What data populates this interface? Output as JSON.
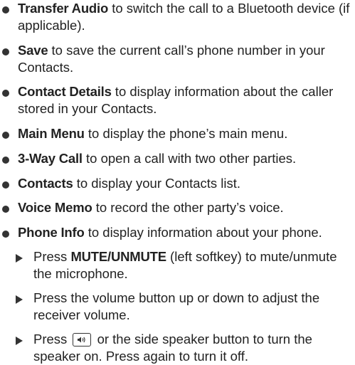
{
  "options": [
    {
      "term": "Transfer Audio",
      "desc": " to switch the call to a Bluetooth device (if applicable)."
    },
    {
      "term": "Save",
      "desc": " to save the current call’s phone number in your Contacts."
    },
    {
      "term": "Contact Details",
      "desc": " to display information about the caller stored in your Contacts."
    },
    {
      "term": "Main Menu",
      "desc": " to display the phone’s main menu."
    },
    {
      "term": "3-Way Call",
      "desc": " to open a call with two other parties."
    },
    {
      "term": "Contacts",
      "desc": " to display your Contacts list."
    },
    {
      "term": "Voice Memo",
      "desc": " to record the other party’s voice."
    },
    {
      "term": "Phone Info",
      "desc": " to display information about your phone."
    }
  ],
  "steps": {
    "mute": {
      "prefix": "Press ",
      "key": "MUTE/UNMUTE",
      "rest": " (left softkey) to mute/unmute the microphone."
    },
    "volume": {
      "text": "Press the volume button up or down to adjust the receiver volume."
    },
    "speaker": {
      "prefix": "Press ",
      "icon": "speaker-key-icon",
      "rest": " or the side speaker button to turn the speaker on. Press again to turn it off."
    }
  }
}
